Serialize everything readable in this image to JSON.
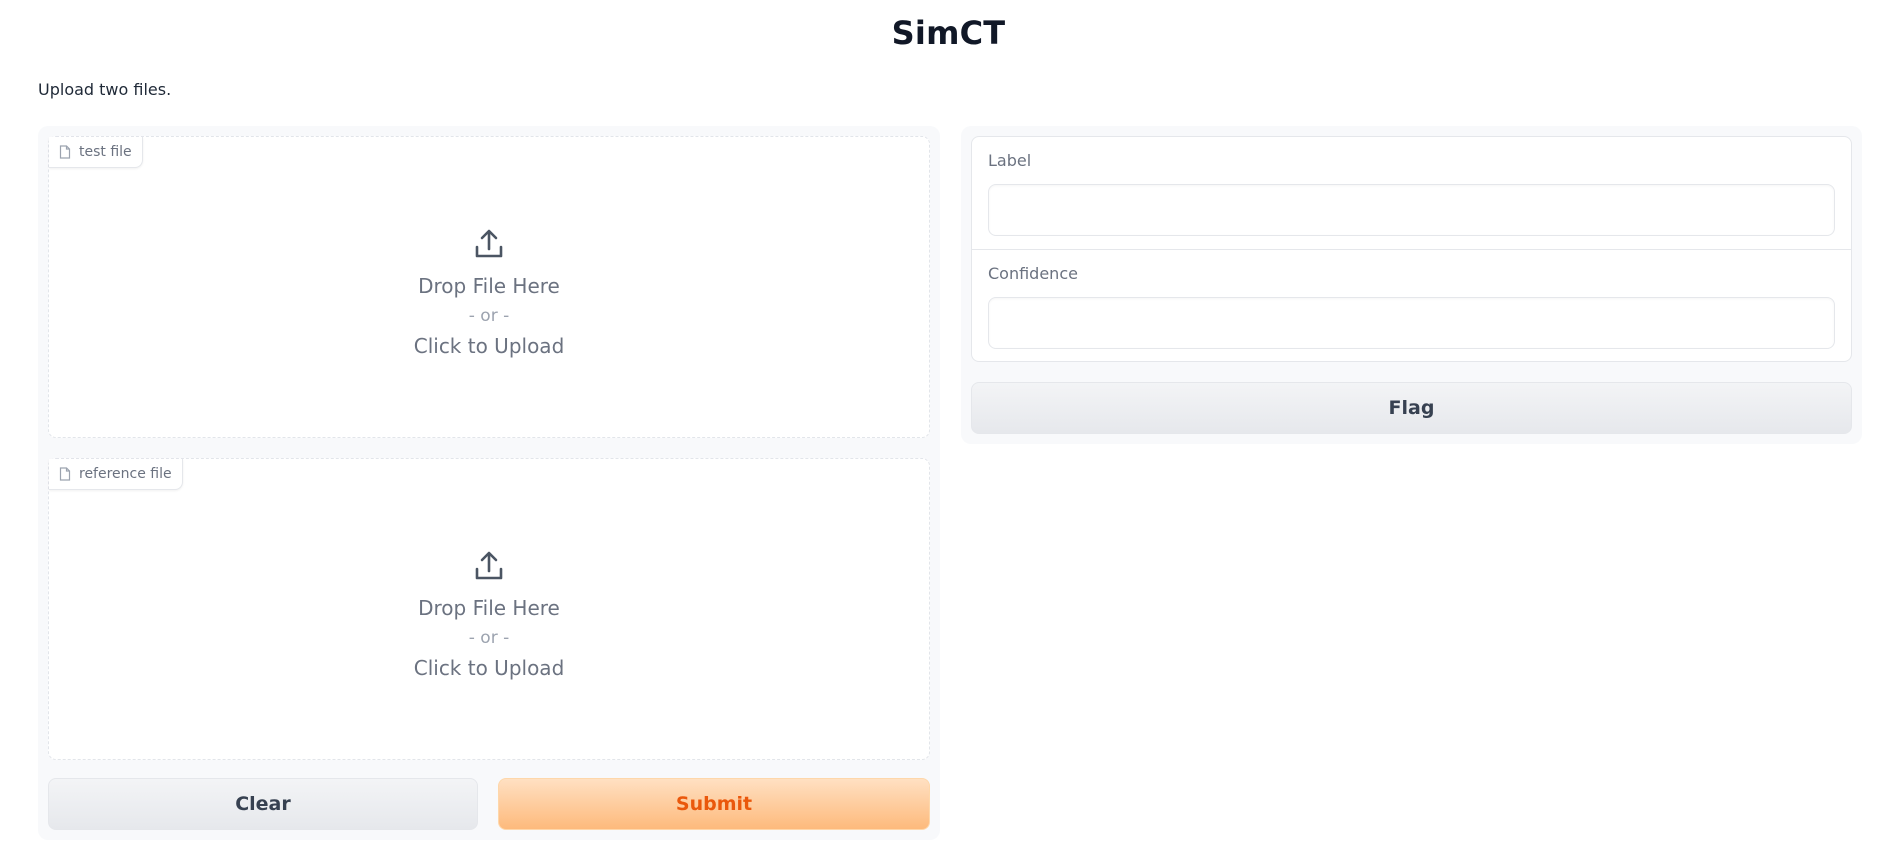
{
  "app": {
    "title": "SimCT",
    "description": "Upload two files."
  },
  "inputs": {
    "files": [
      {
        "label": "test file",
        "icon": "file-icon",
        "upload_icon": "upload-icon",
        "drop_text": "Drop File Here",
        "or_text": "- or -",
        "click_text": "Click to Upload"
      },
      {
        "label": "reference file",
        "icon": "file-icon",
        "upload_icon": "upload-icon",
        "drop_text": "Drop File Here",
        "or_text": "- or -",
        "click_text": "Click to Upload"
      }
    ],
    "clear_label": "Clear",
    "submit_label": "Submit"
  },
  "outputs": {
    "label_title": "Label",
    "label_value": "",
    "confidence_title": "Confidence",
    "confidence_value": "",
    "flag_label": "Flag"
  },
  "colors": {
    "submit_text": "#ea580c",
    "submit_bg_top": "#ffe0c2",
    "submit_bg_bottom": "#fdba7c",
    "panel_bg": "#f8f9fb"
  }
}
